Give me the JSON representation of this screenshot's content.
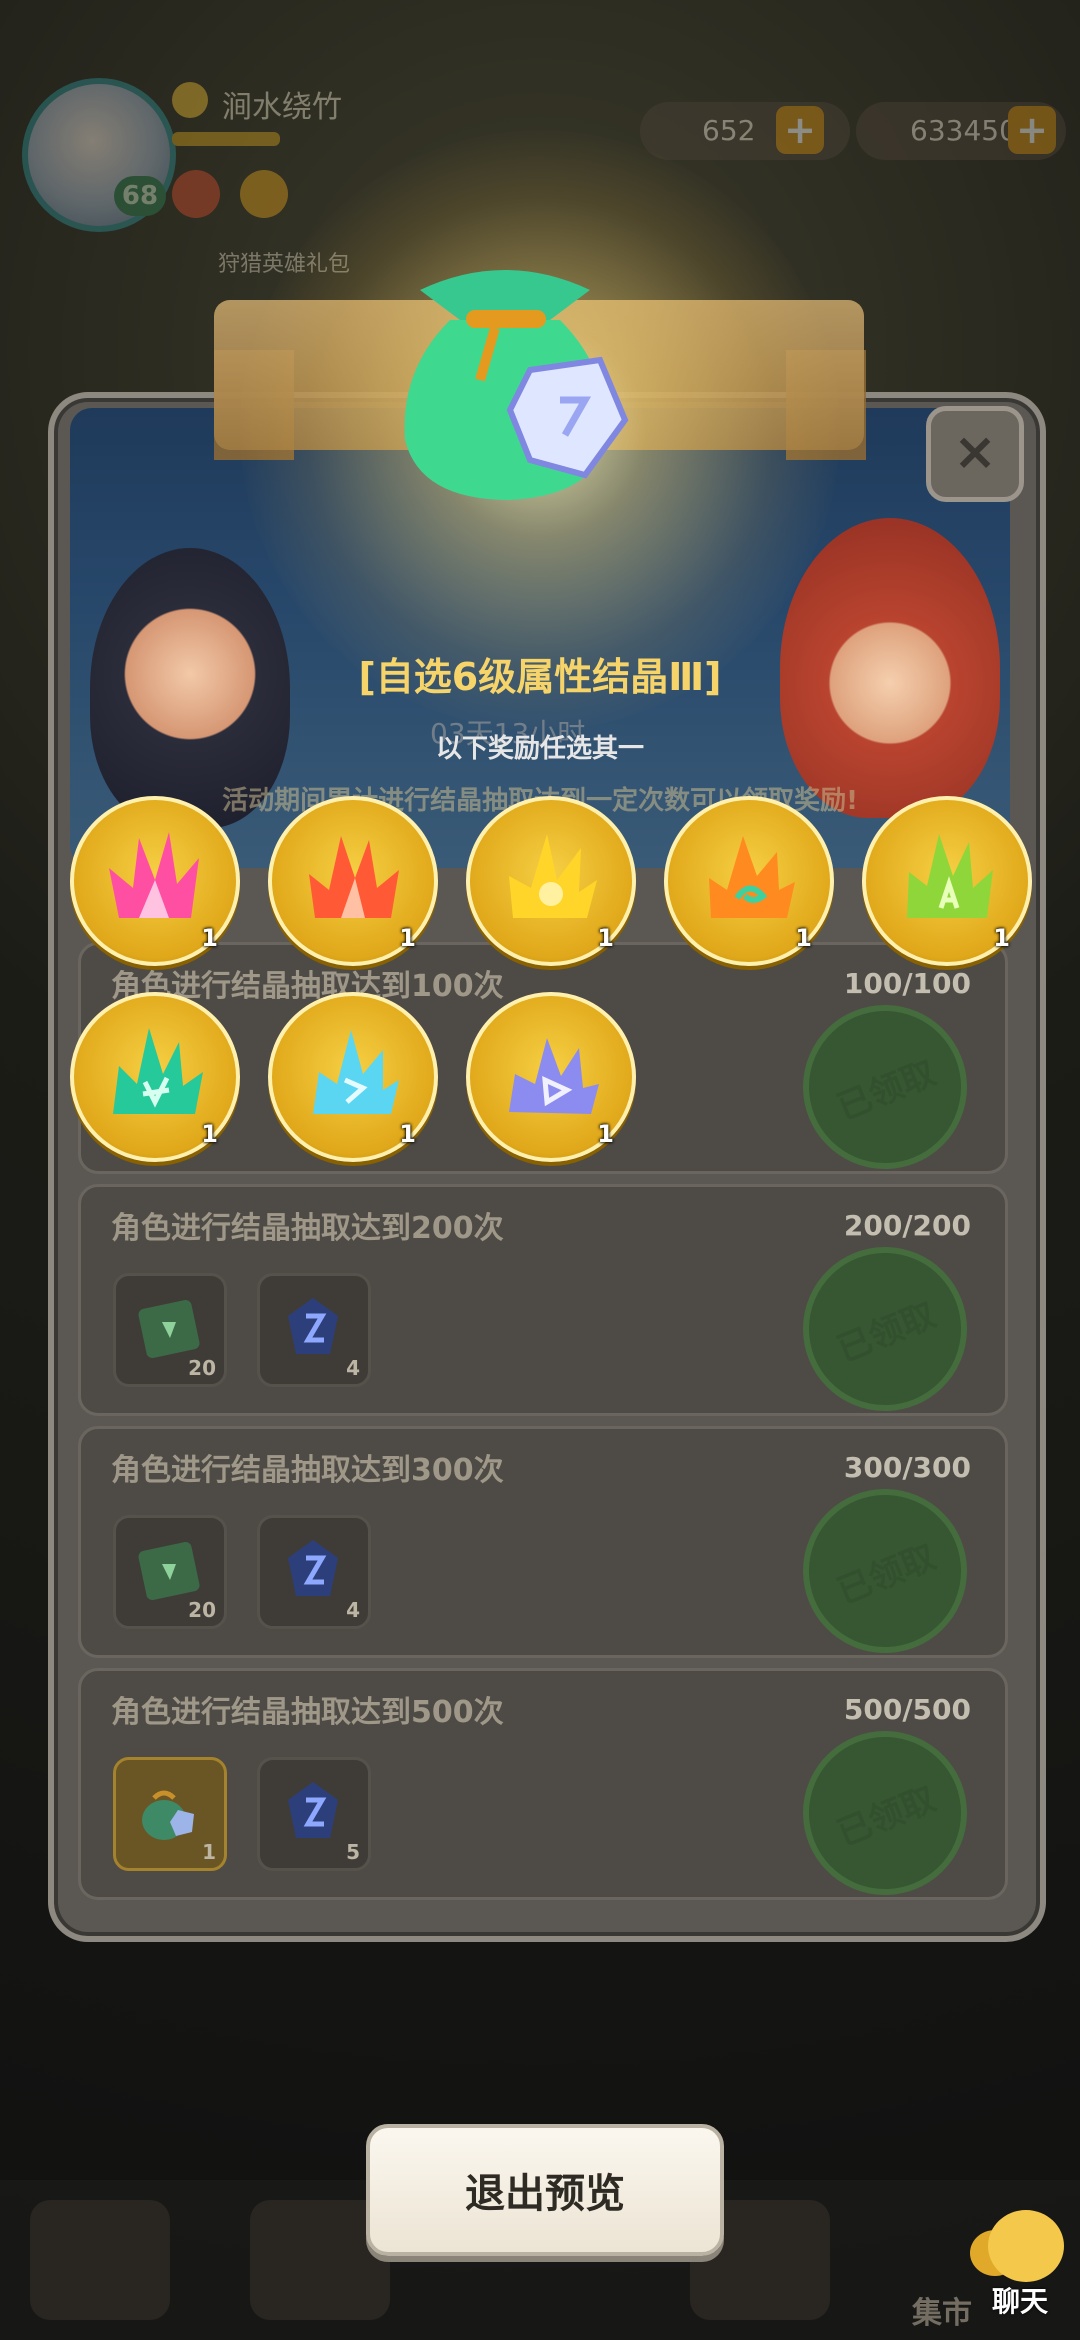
{
  "hud": {
    "player_name": "涧水绕竹",
    "level": "68",
    "currency_1": "652",
    "currency_2": "633450",
    "plus": "+",
    "hunt_gift": "狩猎英雄礼包"
  },
  "preview": {
    "title": "[自选6级属性结晶Ⅲ]",
    "subtitle": "以下奖励任选其一",
    "timer": "03天13小时",
    "notice": "活动期间累计进行结晶抽取达到一定次数可以领取奖励!",
    "close": "×"
  },
  "choices": [
    {
      "name": "pink-crystal",
      "qty": "1",
      "color": "#ff4fa3"
    },
    {
      "name": "red-crystal",
      "qty": "1",
      "color": "#ff5a35"
    },
    {
      "name": "yellow-crystal",
      "qty": "1",
      "color": "#ffd52a"
    },
    {
      "name": "orange-crystal",
      "qty": "1",
      "color": "#ff8a1f"
    },
    {
      "name": "green-crystal",
      "qty": "1",
      "color": "#8fd63a"
    },
    {
      "name": "teal-crystal",
      "qty": "1",
      "color": "#25c99a"
    },
    {
      "name": "cyan-crystal",
      "qty": "1",
      "color": "#5ad6f2"
    },
    {
      "name": "violet-crystal",
      "qty": "1",
      "color": "#8c8cf0"
    }
  ],
  "tasks": [
    {
      "title": "角色进行结晶抽取达到100次",
      "progress": "100/100",
      "items": [],
      "status": "已领取"
    },
    {
      "title": "角色进行结晶抽取达到200次",
      "progress": "200/200",
      "items": [
        {
          "name": "green-ticket",
          "count": "20"
        },
        {
          "name": "blue-crystal",
          "count": "4"
        }
      ],
      "status": "已领取"
    },
    {
      "title": "角色进行结晶抽取达到300次",
      "progress": "300/300",
      "items": [
        {
          "name": "green-ticket",
          "count": "20"
        },
        {
          "name": "blue-crystal",
          "count": "4"
        }
      ],
      "status": "已领取"
    },
    {
      "title": "角色进行结晶抽取达到500次",
      "progress": "500/500",
      "items": [
        {
          "name": "crystal-bag",
          "count": "1"
        },
        {
          "name": "blue-crystal",
          "count": "5"
        }
      ],
      "status": "已领取"
    }
  ],
  "bottom": {
    "exit_preview": "退出预览",
    "chat": "聊天",
    "market": "集市"
  }
}
